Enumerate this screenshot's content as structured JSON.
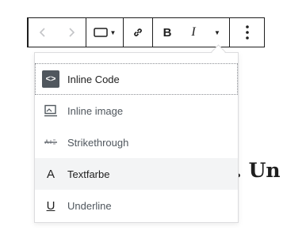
{
  "toolbar": {
    "back_icon": "chevron-left-icon",
    "forward_icon": "chevron-right-icon",
    "block_icon": "rectangle-block-icon",
    "link_icon": "link-icon",
    "bold_label": "B",
    "italic_label": "I",
    "more_icon": "more-vertical-icon"
  },
  "menu": {
    "items": [
      {
        "label": "Inline Code",
        "icon": "code-icon"
      },
      {
        "label": "Inline image",
        "icon": "image-icon"
      },
      {
        "label": "Strikethrough",
        "icon": "strikethrough-icon"
      },
      {
        "label": "Textfarbe",
        "icon": "text-color-icon",
        "glyph": "A"
      },
      {
        "label": "Underline",
        "icon": "underline-icon",
        "glyph": "U"
      }
    ]
  },
  "background_text": "ke. Un",
  "colors": {
    "border": "#1e1e1e",
    "hover_bg": "#f3f4f5",
    "icon_dark": "#50575e"
  }
}
